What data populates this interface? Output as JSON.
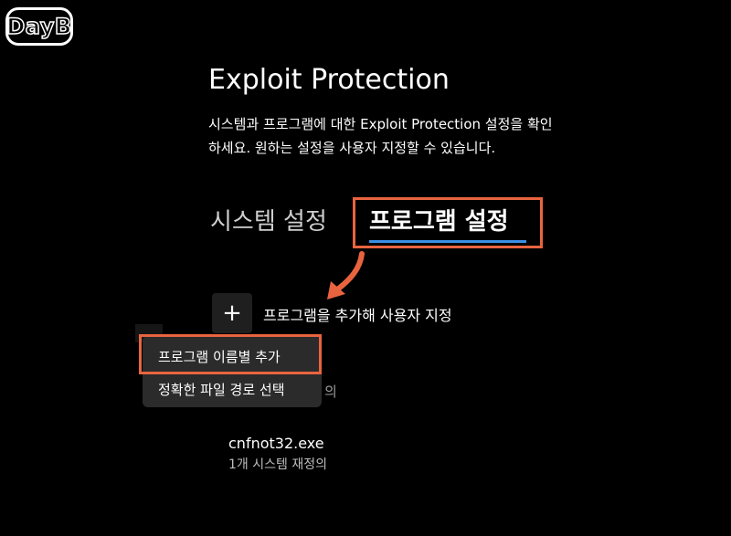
{
  "watermark": {
    "logo_text": "DayB"
  },
  "page": {
    "title": "Exploit Protection",
    "description": "시스템과 프로그램에 대한 Exploit Protection 설정을 확인하세요. 원하는 설정을 사용자 지정할 수 있습니다."
  },
  "tabs": [
    {
      "label": "시스템 설정",
      "selected": false
    },
    {
      "label": "프로그램 설정",
      "selected": true
    }
  ],
  "add_program": {
    "icon": "plus-icon",
    "label": "프로그램을 추가해 사용자 지정"
  },
  "dropdown_menu": {
    "items": [
      {
        "label": "프로그램 이름별 추가"
      },
      {
        "label": "정확한 파일 경로 선택"
      }
    ],
    "partially_hidden_text": "의"
  },
  "program_list": [
    {
      "name": "cnfnot32.exe",
      "detail": "1개 시스템 재정의"
    }
  ],
  "colors": {
    "background": "#000000",
    "accent": "#3b8fe6",
    "annotation": "#e8643f",
    "menu_background": "#2b2b2b"
  }
}
